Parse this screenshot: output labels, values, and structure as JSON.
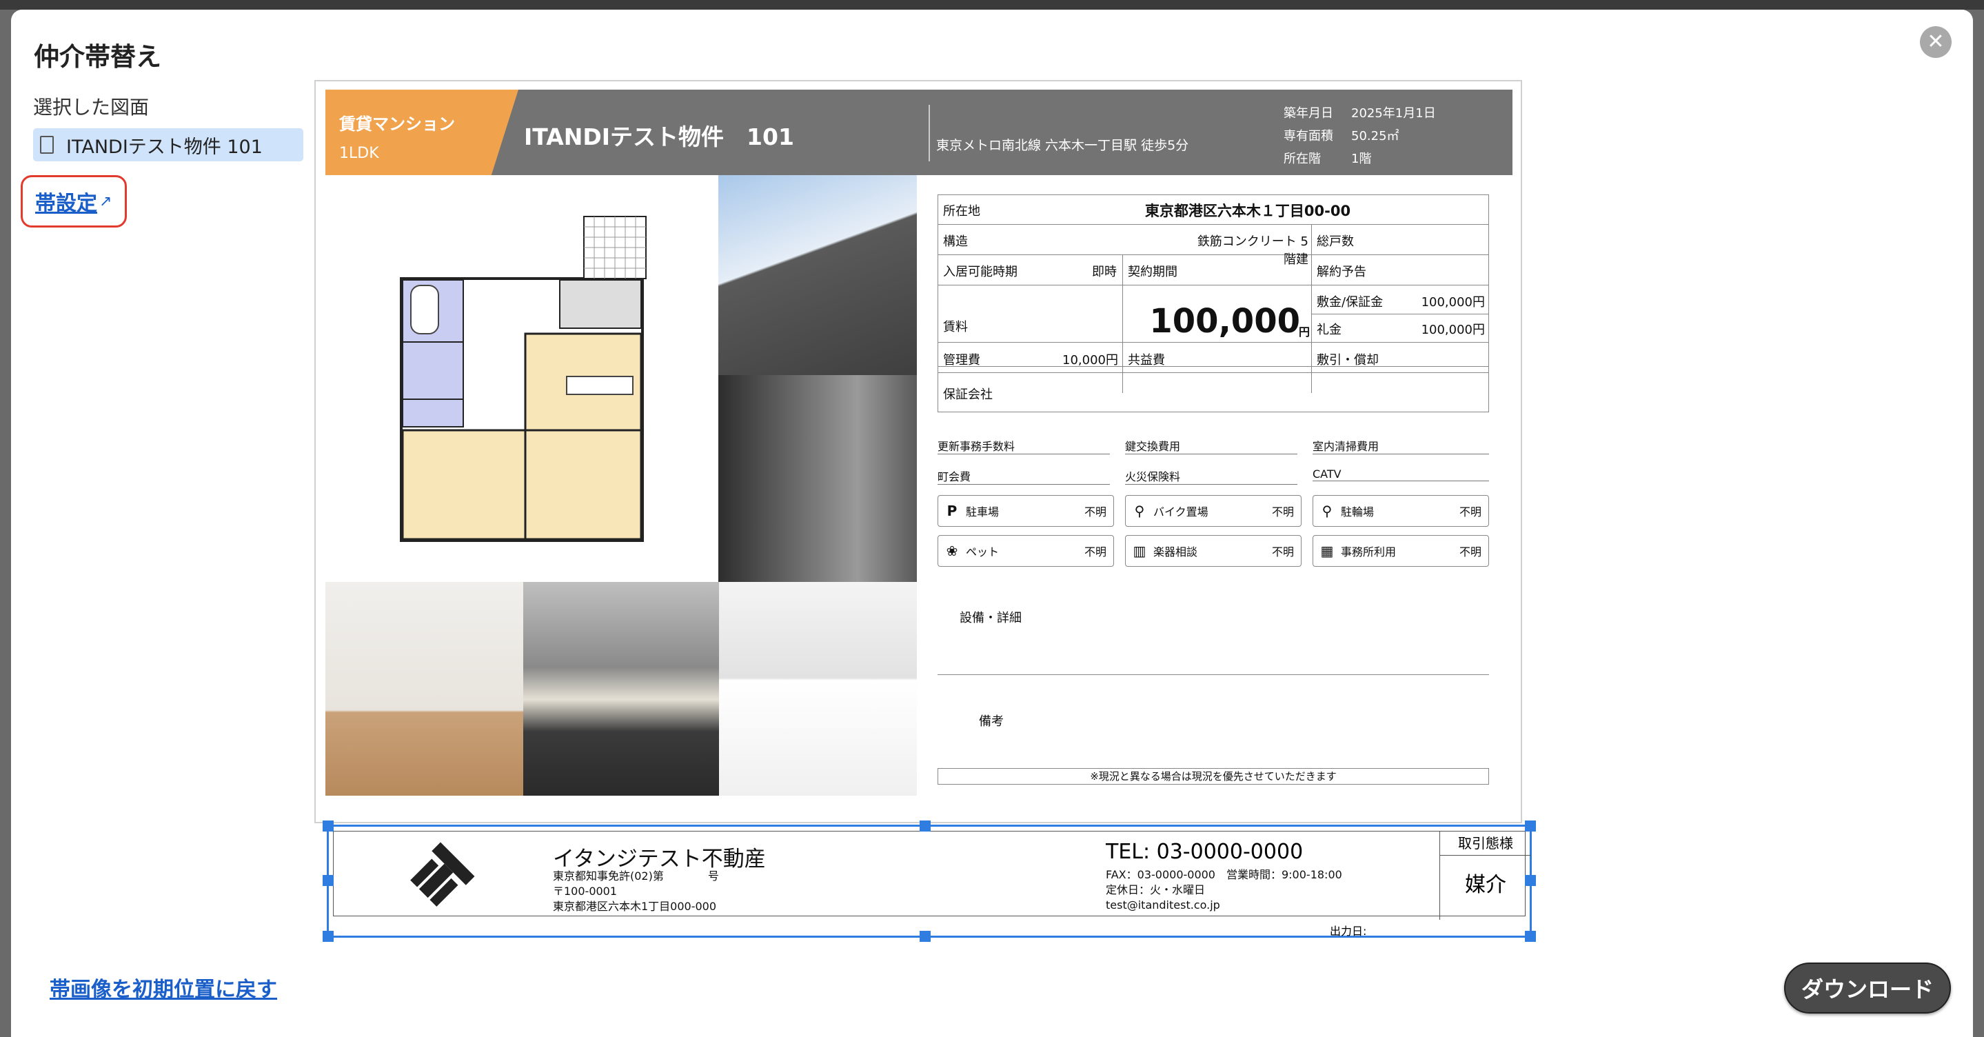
{
  "modal": {
    "title": "仲介帯替え",
    "close_icon": "close-icon",
    "selected_label": "選択した図面",
    "file_name": "ITANDIテスト物件 101",
    "obi_setting_label": "帯設定",
    "reset_label": "帯画像を初期位置に戻す",
    "download_label": "ダウンロード"
  },
  "header": {
    "type": "賃貸マンション",
    "layout": "1LDK",
    "name": "ITANDIテスト物件　101",
    "station": "東京メトロ南北線 六本木一丁目駅 徒歩5分",
    "built_label": "築年月日",
    "built": "2025年1月1日",
    "area_label": "専有面積",
    "area": "50.25㎡",
    "floor_label": "所在階",
    "floor": "1階"
  },
  "details": {
    "address_label": "所在地",
    "address": "東京都港区六本木１丁目00-00",
    "structure_label": "構造",
    "structure": "鉄筋コンクリート 5階建",
    "units_label": "総戸数",
    "movein_label": "入居可能時期",
    "movein": "即時",
    "contract_label": "契約期間",
    "notice_label": "解約予告",
    "rent_label": "賃料",
    "rent": "100,000",
    "yen": "円",
    "deposit_label": "敷金/保証金",
    "deposit": "100,000円",
    "key_label": "礼金",
    "key": "100,000円",
    "mgmt_label": "管理費",
    "mgmt": "10,000円",
    "common_label": "共益費",
    "amort_label": "敷引・償却",
    "guarantor_label": "保証会社",
    "renew_fee": "更新事務手数料",
    "key_fee": "鍵交換費用",
    "clean_fee": "室内清掃費用",
    "town_fee": "町会費",
    "fire_ins": "火災保険料",
    "catv": "CATV",
    "amenities": [
      {
        "icon": "parking-icon",
        "glyph": "P",
        "label": "駐車場",
        "value": "不明"
      },
      {
        "icon": "motorbike-icon",
        "glyph": "⚲",
        "label": "バイク置場",
        "value": "不明"
      },
      {
        "icon": "bicycle-icon",
        "glyph": "⚲",
        "label": "駐輪場",
        "value": "不明"
      },
      {
        "icon": "pet-icon",
        "glyph": "❀",
        "label": "ペット",
        "value": "不明"
      },
      {
        "icon": "instrument-icon",
        "glyph": "▥",
        "label": "楽器相談",
        "value": "不明"
      },
      {
        "icon": "office-icon",
        "glyph": "▦",
        "label": "事務所利用",
        "value": "不明"
      }
    ],
    "equipment_label": "設備・詳細",
    "remarks_label": "備考",
    "disclaimer": "※現況と異なる場合は現況を優先させていただきます"
  },
  "obi": {
    "company": "イタンジテスト不動産",
    "license": "東京都知事免許(02)第　　　　号",
    "postal": "〒100-0001",
    "address": "東京都港区六本木1丁目000-000",
    "tel": "TEL: 03-0000-0000",
    "fax": "FAX：03-0000-0000　営業時間：9:00-18:00",
    "holiday": "定休日：火・水曜日",
    "email": "test@itanditest.co.jp",
    "kind_label": "取引態様",
    "kind": "媒介",
    "output_date": "出力日:"
  }
}
